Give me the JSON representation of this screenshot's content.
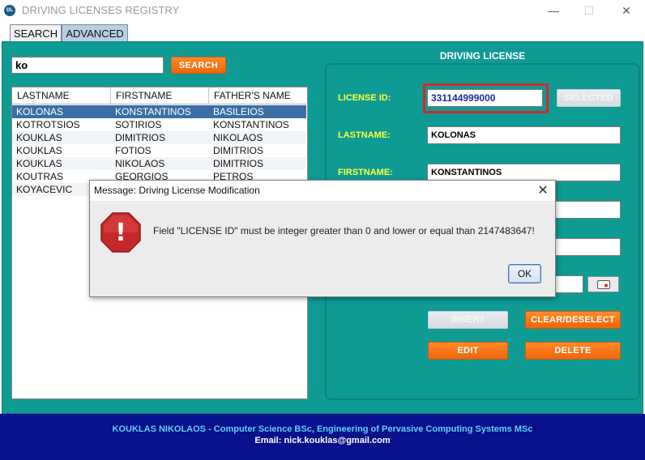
{
  "window": {
    "title": "DRIVING LICENSES REGISTRY",
    "app_icon_text": "DL",
    "controls": {
      "minimize": "—",
      "maximize": "☐",
      "close": "✕"
    }
  },
  "tabs": [
    {
      "label": "SEARCH",
      "active": false
    },
    {
      "label": "ADVANCED",
      "active": true
    }
  ],
  "search": {
    "value": "ko",
    "button_label": "SEARCH"
  },
  "table": {
    "columns": [
      "LASTNAME",
      "FIRSTNAME",
      "FATHER'S NAME"
    ],
    "rows": [
      [
        "KOLONAS",
        "KONSTANTINOS",
        "BASILEIOS"
      ],
      [
        "KOTROTSIOS",
        "SOTIRIOS",
        "KONSTANTINOS"
      ],
      [
        "KOUKLAS",
        "DIMITRIOS",
        "NIKOLAOS"
      ],
      [
        "KOUKLAS",
        "FOTIOS",
        "DIMITRIOS"
      ],
      [
        "KOUKLAS",
        "NIKOLAOS",
        "DIMITRIOS"
      ],
      [
        "KOUTRAS",
        "GEORGIOS",
        "PETROS"
      ],
      [
        "KOYACEVIC",
        "",
        ""
      ]
    ],
    "selected_row": 0
  },
  "form": {
    "title": "DRIVING LICENSE",
    "license_label": "LICENSE ID:",
    "license_value": "331144999000",
    "selected_label": "SELECTED",
    "lastname_label": "LASTNAME:",
    "lastname_value": "KOLONAS",
    "firstname_label": "FIRSTNAME:",
    "firstname_value": "KONSTANTINOS",
    "buttons": {
      "insert": "INSERT",
      "clear": "CLEAR/DESELECT",
      "edit": "EDIT",
      "delete": "DELETE"
    }
  },
  "footer": {
    "line1": "KOUKLAS NIKOLAOS - Computer Science BSc, Engineering of Pervasive Computing Systems MSc",
    "line2": "Email: nick.kouklas@gmail.com"
  },
  "dialog": {
    "title": "Message: Driving License Modification",
    "message": "Field \"LICENSE ID\" must be integer greater than 0 and lower or equal than 2147483647!",
    "ok_label": "OK",
    "close_glyph": "✕",
    "icon": "error-icon",
    "icon_glyph": "!"
  },
  "colors": {
    "panel": "#0e9b94",
    "label": "#ffff3c",
    "orange_button": "#f0650a",
    "footer": "#08108b",
    "selection": "#3a6ea5"
  }
}
